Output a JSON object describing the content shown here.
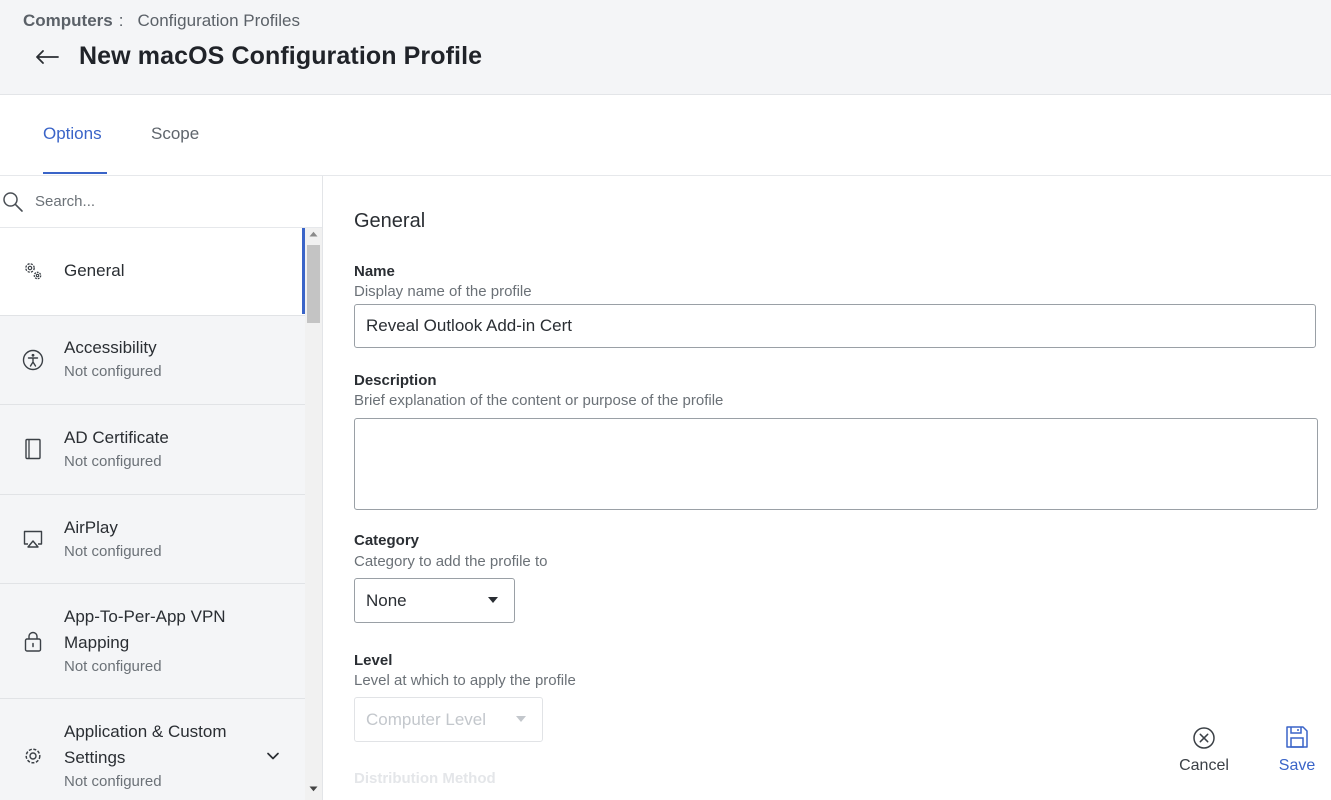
{
  "breadcrumb": {
    "root": "Computers",
    "separator": ":",
    "current": "Configuration Profiles"
  },
  "page_title": "New macOS Configuration Profile",
  "tabs": [
    {
      "label": "Options",
      "active": true
    },
    {
      "label": "Scope",
      "active": false
    }
  ],
  "sidebar": {
    "search_placeholder": "Search...",
    "items": [
      {
        "label": "General",
        "icon": "gears-icon",
        "selected": true
      },
      {
        "label": "Accessibility",
        "status": "Not configured",
        "icon": "accessibility-icon"
      },
      {
        "label": "AD Certificate",
        "status": "Not configured",
        "icon": "certificate-icon"
      },
      {
        "label": "AirPlay",
        "status": "Not configured",
        "icon": "airplay-icon"
      },
      {
        "label_line1": "App-To-Per-App VPN",
        "label_line2": "Mapping",
        "status": "Not configured",
        "icon": "lock-icon"
      },
      {
        "label_line1": "Application & Custom",
        "label_line2": "Settings",
        "status": "Not configured",
        "icon": "gear-icon",
        "expandable": true
      }
    ]
  },
  "form": {
    "section_title": "General",
    "name": {
      "label": "Name",
      "help": "Display name of the profile",
      "value": "Reveal Outlook Add-in Cert"
    },
    "description": {
      "label": "Description",
      "help": "Brief explanation of the content or purpose of the profile",
      "value": ""
    },
    "category": {
      "label": "Category",
      "help": "Category to add the profile to",
      "value": "None"
    },
    "level": {
      "label": "Level",
      "help": "Level at which to apply the profile",
      "value": "Computer Level",
      "disabled": true
    },
    "distribution": {
      "label": "Distribution Method"
    }
  },
  "actions": {
    "cancel": "Cancel",
    "save": "Save"
  },
  "colors": {
    "accent": "#3a64c8",
    "header_bg": "#f4f5f7",
    "sidebar_bg": "#f4f5f7"
  }
}
